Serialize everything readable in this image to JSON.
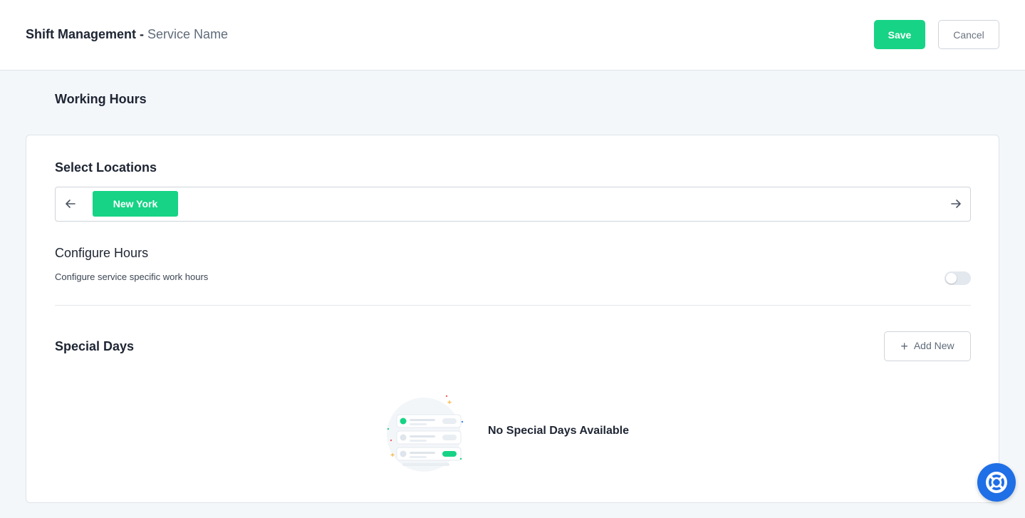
{
  "header": {
    "title": "Shift Management -",
    "subtitle": "Service Name",
    "save_label": "Save",
    "cancel_label": "Cancel"
  },
  "page": {
    "heading": "Working Hours"
  },
  "locations": {
    "label": "Select Locations",
    "items": [
      "New York"
    ],
    "selected": "New York",
    "prev_icon": "arrow-left-icon",
    "next_icon": "arrow-right-icon"
  },
  "configure": {
    "title": "Configure Hours",
    "description": "Configure service specific work hours",
    "toggle_on": false
  },
  "special_days": {
    "title": "Special Days",
    "add_label": "Add New",
    "empty_text": "No Special Days Available"
  },
  "help": {
    "icon": "lifebuoy-icon"
  },
  "colors": {
    "accent": "#17d385",
    "help": "#1f6fe6"
  }
}
